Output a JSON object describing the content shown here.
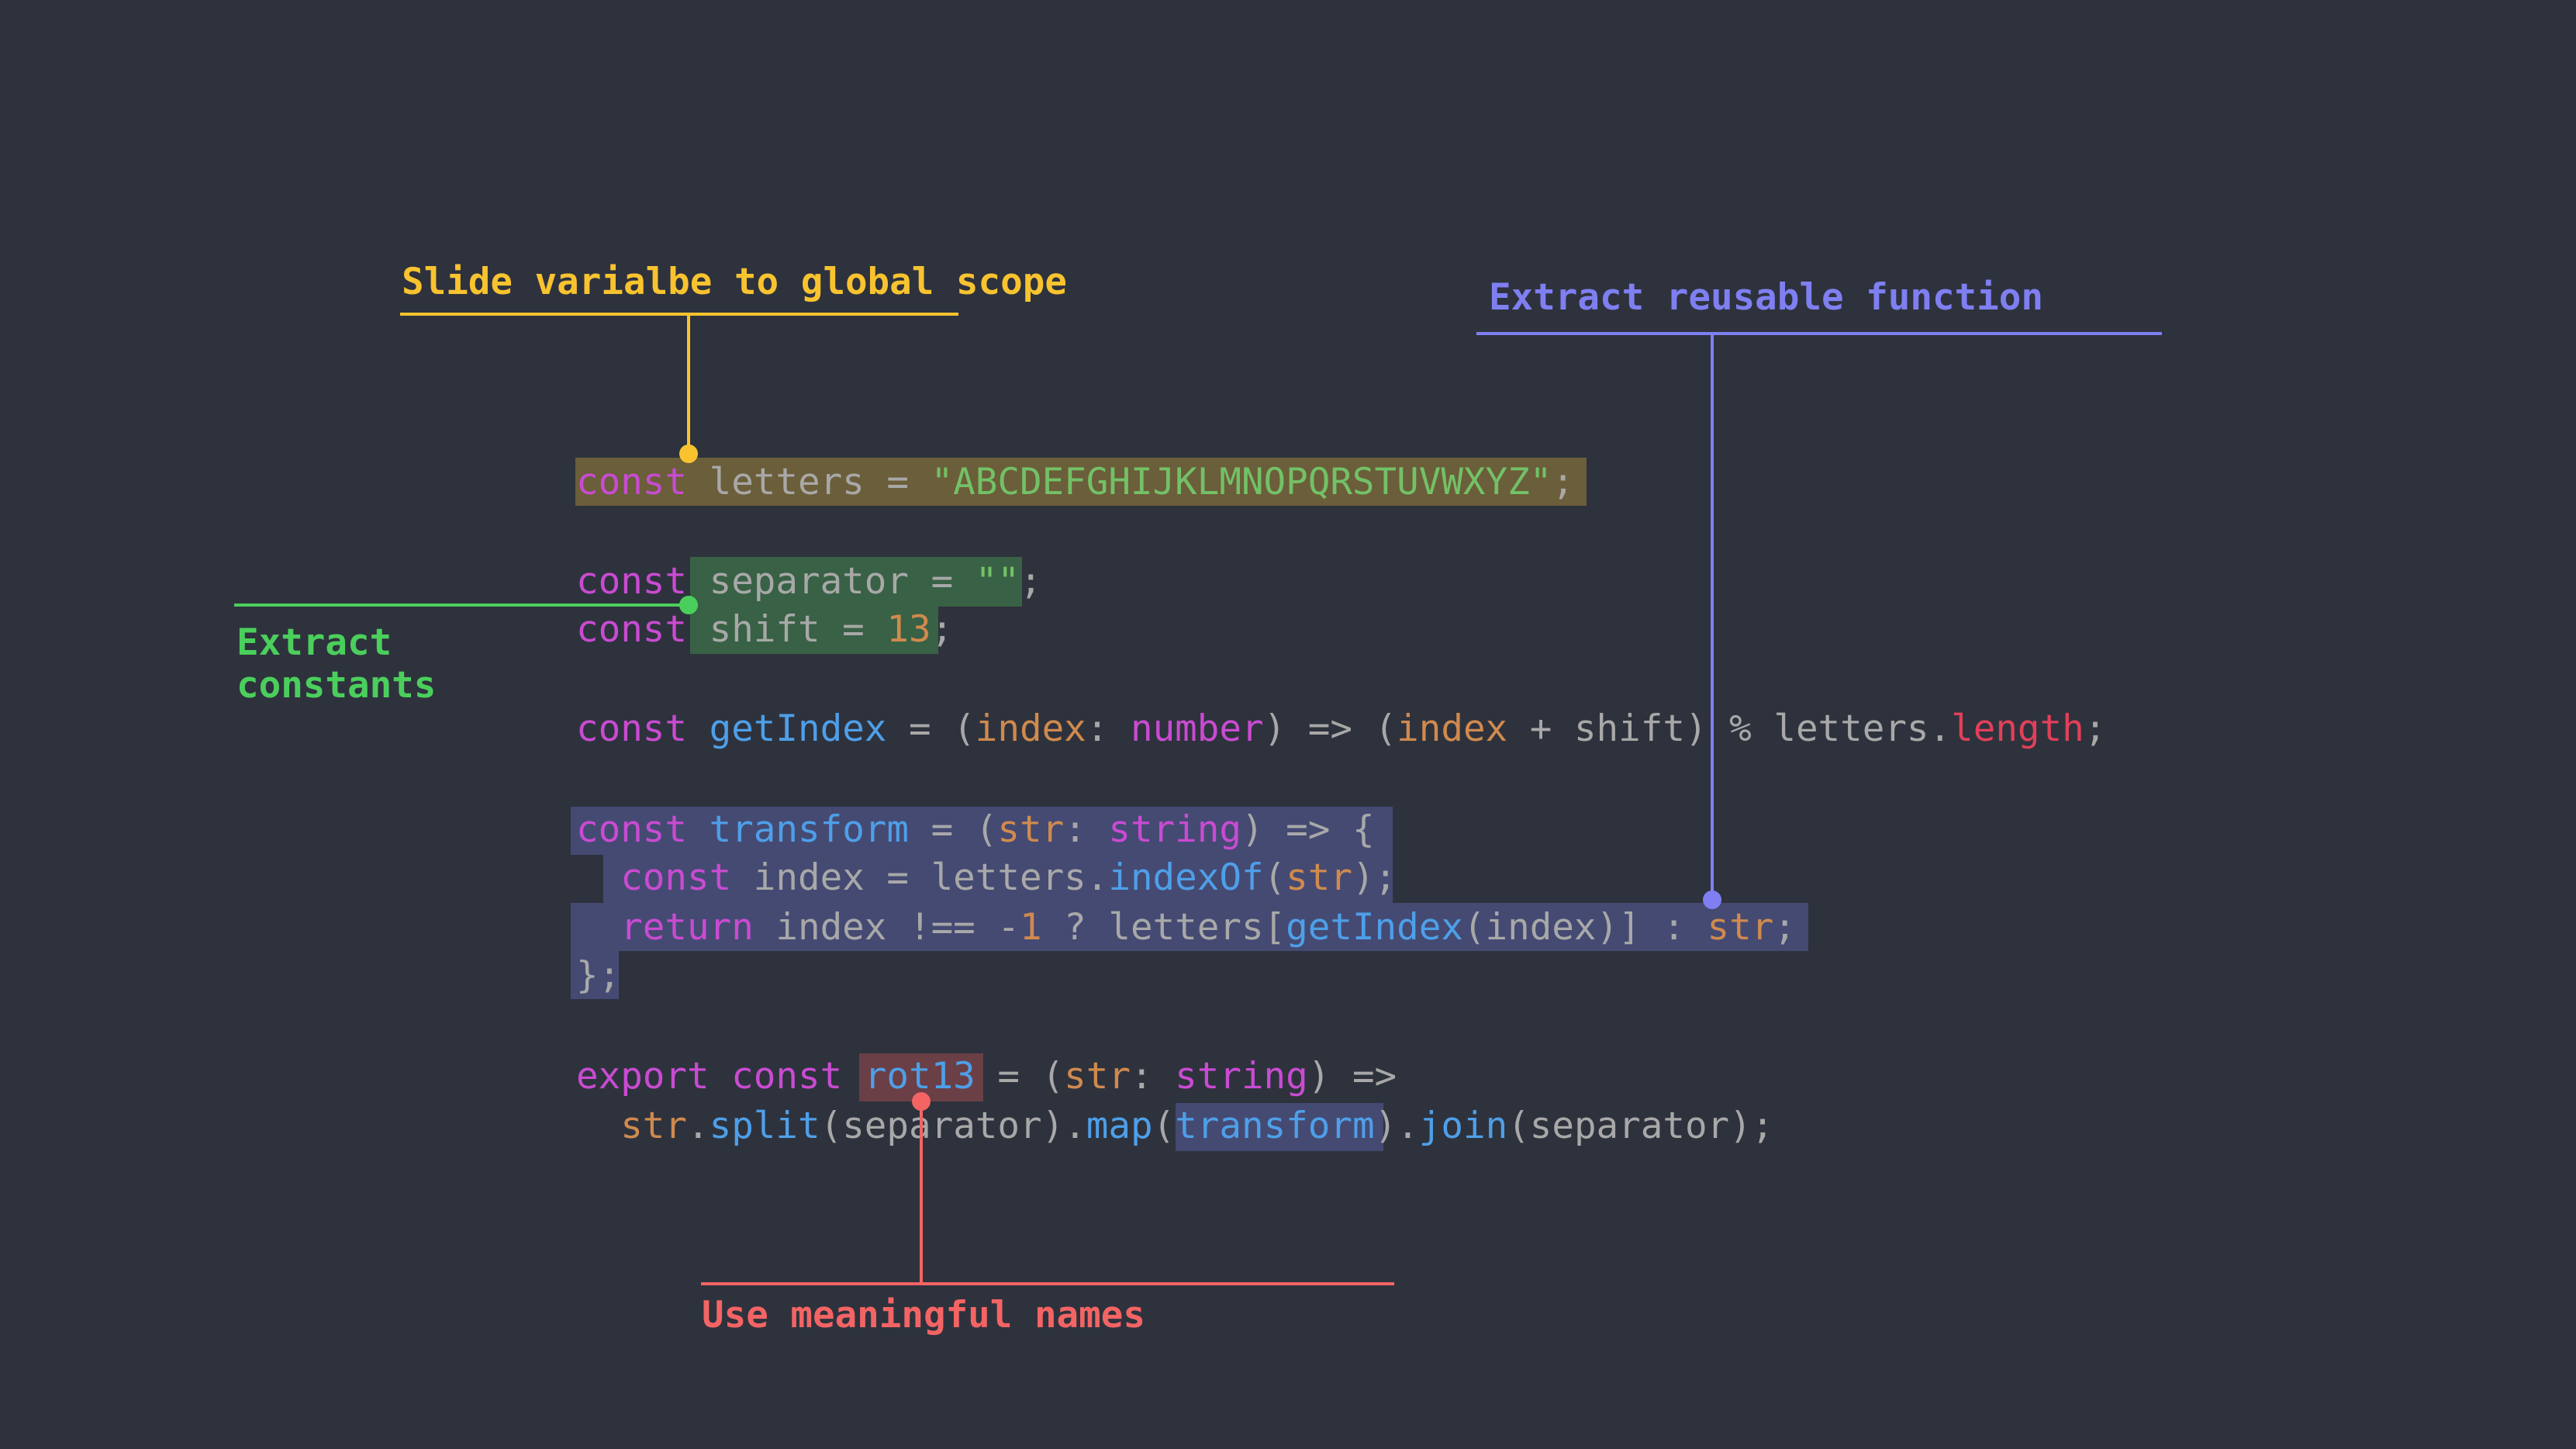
{
  "colors": {
    "background": "#2e323d",
    "yellow": "#f8c32f",
    "green": "#4bcf5c",
    "purple": "#7f7ff2",
    "red": "#f46464"
  },
  "annotations": {
    "slide_variable": "Slide varialbe to global scope",
    "extract_function": "Extract reusable function",
    "extract_constants_line1": "Extract",
    "extract_constants_line2": "constants",
    "meaningful_names": "Use meaningful names"
  },
  "code": {
    "l1": {
      "kw": "const",
      "name": " letters = ",
      "str": "\"ABCDEFGHIJKLMNOPQRSTUVWXYZ\"",
      "end": ";"
    },
    "l2": {
      "kw": "const",
      "rest": " separator = ",
      "str": "\"\"",
      "end": ";"
    },
    "l3": {
      "kw": "const",
      "rest": " shift = ",
      "num": "13",
      "end": ";"
    },
    "l4": {
      "kw": "const",
      "sp": " ",
      "fn": "getIndex",
      "a": " = (",
      "param": "index",
      "b": ": ",
      "type": "number",
      "c": ") => (",
      "param2": "index",
      "d": " + shift) % letters.",
      "prop": "length",
      "end": ";"
    },
    "l5": {
      "kw": "const",
      "sp": " ",
      "fn": "transform",
      "a": " = (",
      "param": "str",
      "b": ": ",
      "type": "string",
      "c": ") => {"
    },
    "l6": {
      "indent": "  ",
      "kw": "const",
      "a": " index = letters.",
      "fn": "indexOf",
      "b": "(",
      "param": "str",
      "c": ");"
    },
    "l7": {
      "indent": "  ",
      "kw": "return",
      "a": " index !== -",
      "num": "1",
      "b": " ? letters[",
      "fn": "getIndex",
      "c": "(index)] : ",
      "param": "str",
      "end": ";"
    },
    "l8": {
      "text": "};"
    },
    "l9": {
      "kw": "export const",
      "sp": " ",
      "fn": "rot13",
      "a": " = (",
      "param": "str",
      "b": ": ",
      "type": "string",
      "c": ") =>"
    },
    "l10": {
      "indent": "  ",
      "param": "str",
      "a": ".",
      "fn": "split",
      "b": "(separator).",
      "fn2": "map",
      "c": "(",
      "fn3": "transform",
      "d": ").",
      "fn4": "join",
      "e": "(separator);"
    }
  }
}
